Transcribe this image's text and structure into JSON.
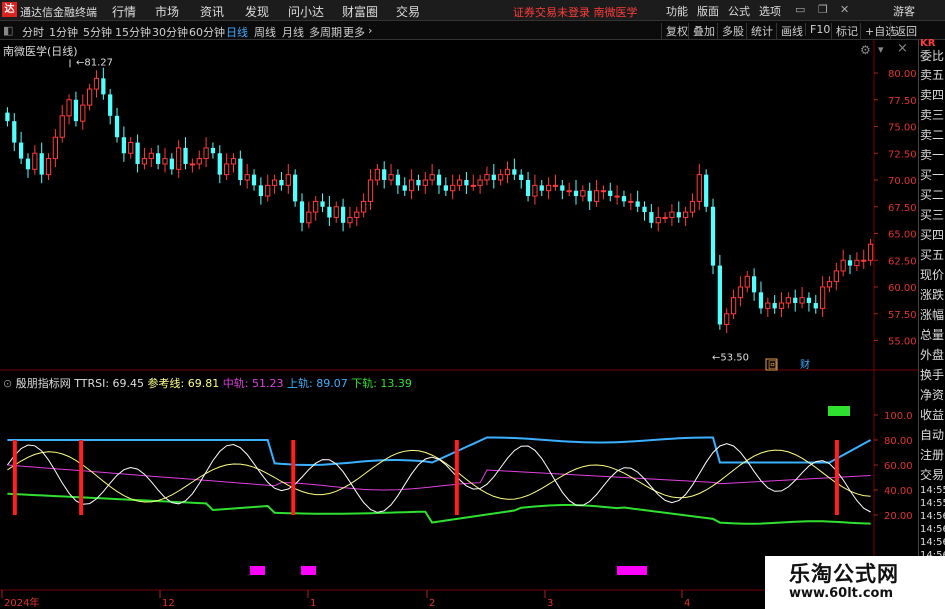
{
  "app": {
    "logo": "达",
    "name": "通达信金融终端",
    "menus": [
      "行情",
      "市场",
      "资讯",
      "发现",
      "问小达",
      "财富圈",
      "交易"
    ],
    "alert": "证券交易未登录  南微医学",
    "window_buttons": [
      "功能",
      "版面",
      "公式",
      "选项"
    ],
    "guest": "游客"
  },
  "toolbar": {
    "periods": [
      "分时",
      "1分钟",
      "5分钟",
      "15分钟",
      "30分钟",
      "60分钟",
      "日线",
      "周线",
      "月线",
      "多周期",
      "更多"
    ],
    "active_period": "日线",
    "right_buttons": [
      "复权",
      "叠加",
      "多股",
      "统计",
      "画线",
      "F10",
      "标记",
      "+自选",
      "返回"
    ]
  },
  "main_chart": {
    "title": "南微医学(日线)",
    "price_axis": [
      "80.00",
      "77.50",
      "75.00",
      "72.50",
      "70.00",
      "67.50",
      "65.00",
      "62.50",
      "60.00",
      "57.50",
      "55.00"
    ],
    "high_label": "81.27",
    "low_label": "53.50",
    "markers": [
      "回",
      "财"
    ],
    "colors": {
      "up": "#ff3b3b",
      "down": "#54ffff"
    }
  },
  "indicator": {
    "name": "殷朋指标网",
    "ttrsi_label": "TTRSI:",
    "ttrsi_value": "69.45",
    "ref_label": "参考线:",
    "ref_value": "69.81",
    "mid_label": "中轨:",
    "mid_value": "51.23",
    "upper_label": "上轨:",
    "upper_value": "89.07",
    "lower_label": "下轨:",
    "lower_value": "13.39",
    "axis": [
      "100.0",
      "80.00",
      "60.00",
      "40.00",
      "20.00"
    ],
    "colors": {
      "ttrsi": "#ffffff",
      "ref": "#ffff80",
      "mid": "#e040e0",
      "upper": "#3ab0ff",
      "lower": "#30e030",
      "signal": "#ff2020",
      "marker": "#ff00ff"
    }
  },
  "x_axis": [
    "2024年",
    "12",
    "1",
    "2",
    "3",
    "4"
  ],
  "right_panel": {
    "top_label": "KR",
    "labels": [
      "委比",
      "卖五",
      "卖四",
      "卖三",
      "卖二",
      "卖一",
      "买一",
      "买二",
      "买三",
      "买四",
      "买五",
      "现价",
      "涨跌",
      "涨幅",
      "总量",
      "外盘",
      "换手",
      "净资",
      "收益",
      "自动",
      "注册",
      "交易"
    ],
    "times": [
      "14:55",
      "14:55",
      "14:56",
      "14:56",
      "14:56",
      "14:56"
    ]
  },
  "watermark": {
    "title": "乐淘公式网",
    "url": "www.60lt.com"
  }
}
